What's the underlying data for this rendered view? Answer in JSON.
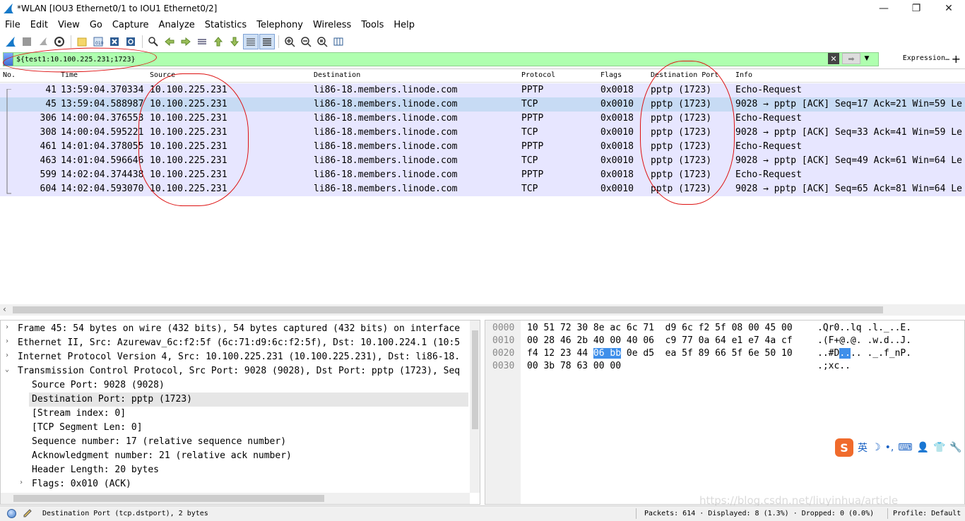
{
  "window": {
    "title": "*WLAN [IOU3 Ethernet0/1 to IOU1 Ethernet0/2]",
    "minimize": "—",
    "maximize": "❐",
    "close": "✕"
  },
  "menu": [
    "File",
    "Edit",
    "View",
    "Go",
    "Capture",
    "Analyze",
    "Statistics",
    "Telephony",
    "Wireless",
    "Tools",
    "Help"
  ],
  "filter": {
    "value": "${test1:10.100.225.231;1723}",
    "expression_label": "Expression…",
    "add_label": "+"
  },
  "packet_list": {
    "columns": [
      "No.",
      "Time",
      "Source",
      "Destination",
      "Protocol",
      "Flags",
      "Destination Port",
      "Info"
    ],
    "rows": [
      {
        "no": "41",
        "time": "13:59:04.370334",
        "src": "10.100.225.231",
        "dst": "li86-18.members.linode.com",
        "proto": "PPTP",
        "flags": "0x0018",
        "dport": "pptp (1723)",
        "info": "Echo-Request",
        "selected": false
      },
      {
        "no": "45",
        "time": "13:59:04.588987",
        "src": "10.100.225.231",
        "dst": "li86-18.members.linode.com",
        "proto": "TCP",
        "flags": "0x0010",
        "dport": "pptp (1723)",
        "info": "9028 → pptp [ACK] Seq=17 Ack=21 Win=59 Le",
        "selected": true
      },
      {
        "no": "306",
        "time": "14:00:04.376553",
        "src": "10.100.225.231",
        "dst": "li86-18.members.linode.com",
        "proto": "PPTP",
        "flags": "0x0018",
        "dport": "pptp (1723)",
        "info": "Echo-Request",
        "selected": false
      },
      {
        "no": "308",
        "time": "14:00:04.595221",
        "src": "10.100.225.231",
        "dst": "li86-18.members.linode.com",
        "proto": "TCP",
        "flags": "0x0010",
        "dport": "pptp (1723)",
        "info": "9028 → pptp [ACK] Seq=33 Ack=41 Win=59 Le",
        "selected": false
      },
      {
        "no": "461",
        "time": "14:01:04.378055",
        "src": "10.100.225.231",
        "dst": "li86-18.members.linode.com",
        "proto": "PPTP",
        "flags": "0x0018",
        "dport": "pptp (1723)",
        "info": "Echo-Request",
        "selected": false
      },
      {
        "no": "463",
        "time": "14:01:04.596646",
        "src": "10.100.225.231",
        "dst": "li86-18.members.linode.com",
        "proto": "TCP",
        "flags": "0x0010",
        "dport": "pptp (1723)",
        "info": "9028 → pptp [ACK] Seq=49 Ack=61 Win=64 Le",
        "selected": false
      },
      {
        "no": "599",
        "time": "14:02:04.374438",
        "src": "10.100.225.231",
        "dst": "li86-18.members.linode.com",
        "proto": "PPTP",
        "flags": "0x0018",
        "dport": "pptp (1723)",
        "info": "Echo-Request",
        "selected": false
      },
      {
        "no": "604",
        "time": "14:02:04.593070",
        "src": "10.100.225.231",
        "dst": "li86-18.members.linode.com",
        "proto": "TCP",
        "flags": "0x0010",
        "dport": "pptp (1723)",
        "info": "9028 → pptp [ACK] Seq=65 Ack=81 Win=64 Le",
        "selected": false
      }
    ]
  },
  "details": [
    {
      "text": "Frame 45: 54 bytes on wire (432 bits), 54 bytes captured (432 bits) on interface",
      "toggle": "›",
      "highlight": false
    },
    {
      "text": "Ethernet II, Src: Azurewav_6c:f2:5f (6c:71:d9:6c:f2:5f), Dst: 10.100.224.1 (10:5",
      "toggle": "›",
      "highlight": false
    },
    {
      "text": "Internet Protocol Version 4, Src: 10.100.225.231 (10.100.225.231), Dst: li86-18.",
      "toggle": "›",
      "highlight": false
    },
    {
      "text": "Transmission Control Protocol, Src Port: 9028 (9028), Dst Port: pptp (1723), Seq",
      "toggle": "⌄",
      "highlight": false
    },
    {
      "text": "Source Port: 9028 (9028)",
      "toggle": "",
      "highlight": false
    },
    {
      "text": "Destination Port: pptp (1723)",
      "toggle": "",
      "highlight": true
    },
    {
      "text": "[Stream index: 0]",
      "toggle": "",
      "highlight": false
    },
    {
      "text": "[TCP Segment Len: 0]",
      "toggle": "",
      "highlight": false
    },
    {
      "text": "Sequence number: 17    (relative sequence number)",
      "toggle": "",
      "highlight": false
    },
    {
      "text": "Acknowledgment number: 21    (relative ack number)",
      "toggle": "",
      "highlight": false
    },
    {
      "text": "Header Length: 20 bytes",
      "toggle": "",
      "highlight": false
    },
    {
      "text": "Flags: 0x010 (ACK)",
      "toggle": "›",
      "highlight": false
    }
  ],
  "bytes": [
    {
      "off": "0000",
      "hex_a": "10 51 72 30 8e ac 6c 71  d9 6c f2 5f 08 00 45 00",
      "hex_hl": "",
      "hex_b": "",
      "asc_a": ".Qr0..lq .l._..E.",
      "asc_hl": "",
      "asc_b": ""
    },
    {
      "off": "0010",
      "hex_a": "00 28 46 2b 40 00 40 06  c9 77 0a 64 e1 e7 4a cf",
      "hex_hl": "",
      "hex_b": "",
      "asc_a": ".(F+@.@. .w.d..J.",
      "asc_hl": "",
      "asc_b": ""
    },
    {
      "off": "0020",
      "hex_a": "f4 12 23 44 ",
      "hex_hl": "06 bb",
      "hex_b": " 0e d5  ea 5f 89 66 5f 6e 50 10",
      "asc_a": "..#D",
      "asc_hl": "..",
      "asc_b": ".. ._.f_nP."
    },
    {
      "off": "0030",
      "hex_a": "00 3b 78 63 00 00",
      "hex_hl": "",
      "hex_b": "",
      "asc_a": ".;xc..",
      "asc_hl": "",
      "asc_b": ""
    }
  ],
  "ime": {
    "lang": "英",
    "glyphs": [
      "☽",
      "•,",
      "⌨",
      "👤",
      "👕",
      "🔧"
    ]
  },
  "status": {
    "field": "Destination Port (tcp.dstport), 2 bytes",
    "packets": "Packets: 614 · Displayed: 8 (1.3%) · Dropped: 0 (0.0%)",
    "profile": "Profile: Default"
  },
  "watermark": "https://blog.csdn.net/liuyinhua/article"
}
